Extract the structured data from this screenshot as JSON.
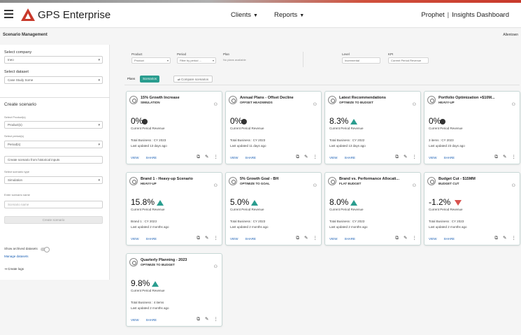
{
  "header": {
    "brand": "GPS Enterprise",
    "nav": [
      {
        "label": "Clients"
      },
      {
        "label": "Reports"
      }
    ],
    "right_left": "Prophet",
    "right_sep": "|",
    "right_right": "Insights Dashboard"
  },
  "page": {
    "title": "Scenario Management",
    "right_label": "Allentown"
  },
  "sidebar": {
    "select_company_label": "Select company",
    "select_company_value": "Ineo",
    "select_dataset_label": "Select dataset",
    "select_dataset_value": "Case Study Some",
    "create_title": "Create scenario",
    "product_label": "Select Product(s)",
    "product_value": "Product(s)",
    "period_label": "Select period(s)",
    "period_value": "Period(s)",
    "import_placeholder": "Create scenario from historical inputs",
    "type_label": "Select scenario type",
    "type_value": "Simulation",
    "name_label": "Enter scenario name",
    "name_placeholder": "Scenario name",
    "create_button": "Create scenario",
    "archived_label": "Show archived datasets",
    "manage_link": "Manage datasets",
    "logout": "Create logs"
  },
  "filters": {
    "product_label": "Product",
    "product_value": "Product",
    "period_label": "Period",
    "period_value": "Filter by period ...",
    "plan_label": "Plan",
    "plan_value": "No plans available",
    "level_label": "Level",
    "level_value": "Incremental",
    "kpi_label": "KPI",
    "kpi_value": "Current Period Revenue"
  },
  "tabs": {
    "plan": "Plans",
    "scenarios": "Scenarios",
    "compare": "Compare scenarios"
  },
  "colors": {
    "accent": "#2a9d8f",
    "up": "#2a9d8f",
    "down": "#d9534f",
    "link": "#1a5fb4"
  },
  "cards": [
    {
      "title": "15% Growth Increase",
      "subtitle": "SIMULATION",
      "pct": "0%",
      "indicator": "flat",
      "metric": "Current Period Revenue",
      "meta1": "Total Business : CY 2023",
      "meta2": "Last updated 13 days ago",
      "view": "VIEW",
      "share": "SHARE"
    },
    {
      "title": "Annual Plans - Offset Decline",
      "subtitle": "OFFSET HEADWINDS",
      "pct": "0%",
      "indicator": "flat",
      "metric": "Current Period Revenue",
      "meta1": "Total Business : CY 2023",
      "meta2": "Last updated 11 days ago",
      "view": "VIEW",
      "share": "SHARE"
    },
    {
      "title": "Latest Recommendations",
      "subtitle": "OPTIMIZE TO BUDGET",
      "pct": "8.3%",
      "indicator": "up",
      "metric": "Current Period Revenue",
      "meta1": "Total Business : CY 2022",
      "meta2": "Last updated 13 days ago",
      "view": "VIEW",
      "share": "SHARE"
    },
    {
      "title": "Portfolio Optimization +$10M...",
      "subtitle": "HEAVY-UP",
      "pct": "0%",
      "indicator": "flat",
      "metric": "Current Period Revenue",
      "meta1": "3 items : CY 2023",
      "meta2": "Last updated 23 days ago",
      "view": "VIEW",
      "share": "SHARE"
    },
    {
      "title": "Brand 1 - Heavy-up Scenario",
      "subtitle": "HEAVY-UP",
      "pct": "15.8%",
      "indicator": "up",
      "metric": "Current Period Revenue",
      "meta1": "Brand 1 : CY 2023",
      "meta2": "Last updated 2 months ago",
      "view": "VIEW",
      "share": "SHARE"
    },
    {
      "title": "5% Growth Goal - BH",
      "subtitle": "OPTIMIZE TO GOAL",
      "pct": "5.0%",
      "indicator": "up",
      "metric": "Current Period Revenue",
      "meta1": "Total Business : CY 2023",
      "meta2": "Last updated 2 months ago",
      "view": "VIEW",
      "share": "SHARE"
    },
    {
      "title": "Brand vs. Performance Allocati...",
      "subtitle": "FLAT BUDGET",
      "pct": "8.0%",
      "indicator": "up",
      "metric": "Current Period Revenue",
      "meta1": "Total Business : CY 2023",
      "meta2": "Last updated 2 months ago",
      "view": "VIEW",
      "share": "SHARE"
    },
    {
      "title": "Budget Cut - $15MM",
      "subtitle": "BUDGET CUT",
      "pct": "-1.2%",
      "indicator": "down",
      "metric": "Current Period Revenue",
      "meta1": "Total Business : CY 2023",
      "meta2": "Last updated 2 months ago",
      "view": "VIEW",
      "share": "SHARE"
    },
    {
      "title": "Quarterly Planning - 2023",
      "subtitle": "OPTIMIZE TO BUDGET",
      "pct": "9.8%",
      "indicator": "up",
      "metric": "Current Period Revenue",
      "meta1": "Total Business : 4 items",
      "meta2": "Last updated 2 months ago",
      "view": "VIEW",
      "share": "SHARE"
    }
  ]
}
